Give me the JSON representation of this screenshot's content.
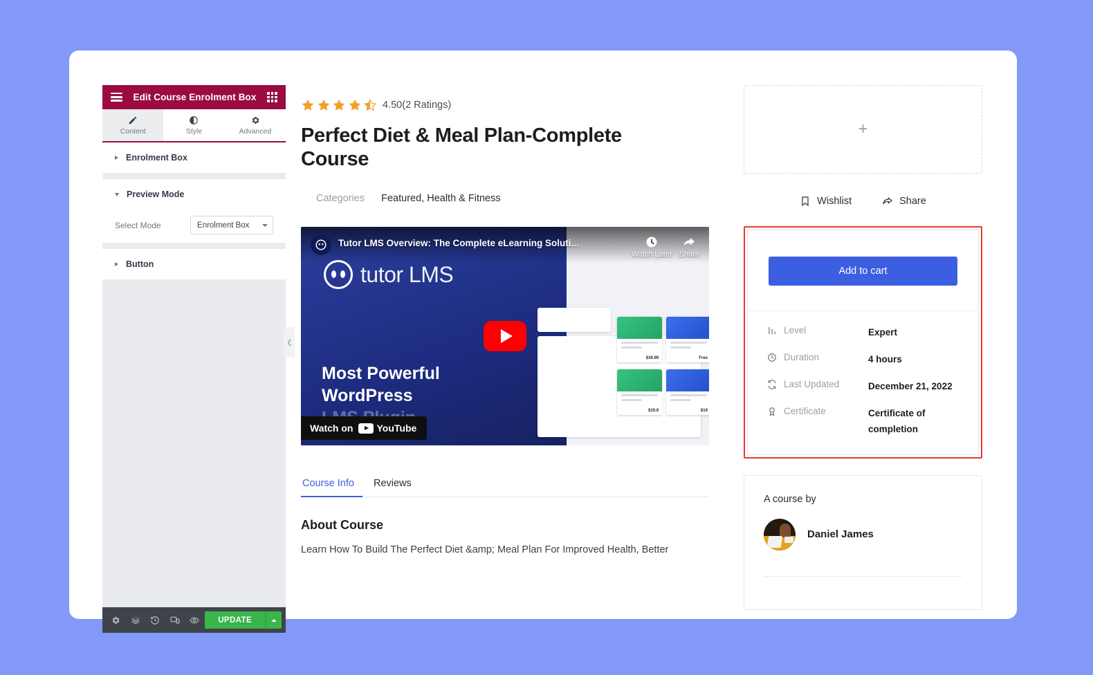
{
  "theme": {
    "page_background": "#8399f7",
    "panel_header_bg": "#9b0b41",
    "accent_blue": "#3c5ee0",
    "update_green": "#39b54a",
    "highlight_red": "#e8392e",
    "star_orange": "#f0a02a"
  },
  "panel": {
    "title": "Edit Course Enrolment Box",
    "menu_icon": "hamburger-icon",
    "grid_icon": "grid-icon",
    "tabs": [
      {
        "label": "Content",
        "icon": "pencil-icon",
        "active": true
      },
      {
        "label": "Style",
        "icon": "contrast-icon",
        "active": false
      },
      {
        "label": "Advanced",
        "icon": "gear-icon",
        "active": false
      }
    ],
    "sections": [
      {
        "label": "Enrolment Box",
        "expanded": false
      },
      {
        "label": "Preview Mode",
        "expanded": true
      },
      {
        "label": "Button",
        "expanded": false
      }
    ],
    "controls": {
      "select_mode_label": "Select Mode",
      "select_mode_value": "Enrolment Box"
    },
    "footer": {
      "icons": [
        "gear-icon",
        "layers-icon",
        "history-icon",
        "responsive-icon",
        "preview-eye-icon"
      ],
      "update_label": "UPDATE",
      "update_caret_icon": "caret-up-icon"
    },
    "collapse_handle_icon": "chevron-left-icon"
  },
  "course": {
    "rating_value": "4.50",
    "rating_count_text": "(2 Ratings)",
    "rating_stars_filled": 4,
    "rating_stars_half": 1,
    "title": "Perfect Diet & Meal Plan-Complete Course",
    "categories_label": "Categories",
    "categories_value": "Featured, Health & Fitness"
  },
  "video": {
    "title": "Tutor LMS Overview: The Complete eLearning Soluti...",
    "watch_later_label": "Watch Later",
    "share_label": "Share",
    "logo_text": "tutor",
    "logo_text_light": "LMS",
    "headline_line1": "Most Powerful",
    "headline_line2": "WordPress",
    "headline_line3": "LMS Plugin",
    "watch_on_label": "Watch on",
    "provider_label": "YouTube",
    "play_icon": "play-button-icon"
  },
  "tabs": {
    "items": [
      {
        "label": "Course Info",
        "active": true
      },
      {
        "label": "Reviews",
        "active": false
      }
    ]
  },
  "about": {
    "heading": "About Course",
    "paragraph": "Learn How To Build The Perfect Diet &amp; Meal Plan For Improved Health, Better"
  },
  "sidebar": {
    "drop_zone_icon": "plus-icon",
    "wishlist_label": "Wishlist",
    "wishlist_icon": "bookmark-icon",
    "share_label": "Share",
    "share_icon": "share-arrow-icon",
    "enrolment": {
      "cart_button_label": "Add to cart",
      "meta": [
        {
          "icon": "signal-bars-icon",
          "key": "Level",
          "value": "Expert"
        },
        {
          "icon": "clock-icon",
          "key": "Duration",
          "value": "4 hours"
        },
        {
          "icon": "sync-icon",
          "key": "Last Updated",
          "value": "December 21, 2022"
        },
        {
          "icon": "award-icon",
          "key": "Certificate",
          "value": "Certificate of completion"
        }
      ]
    },
    "author": {
      "heading": "A course by",
      "name": "Daniel James",
      "avatar_icon": "avatar"
    }
  }
}
